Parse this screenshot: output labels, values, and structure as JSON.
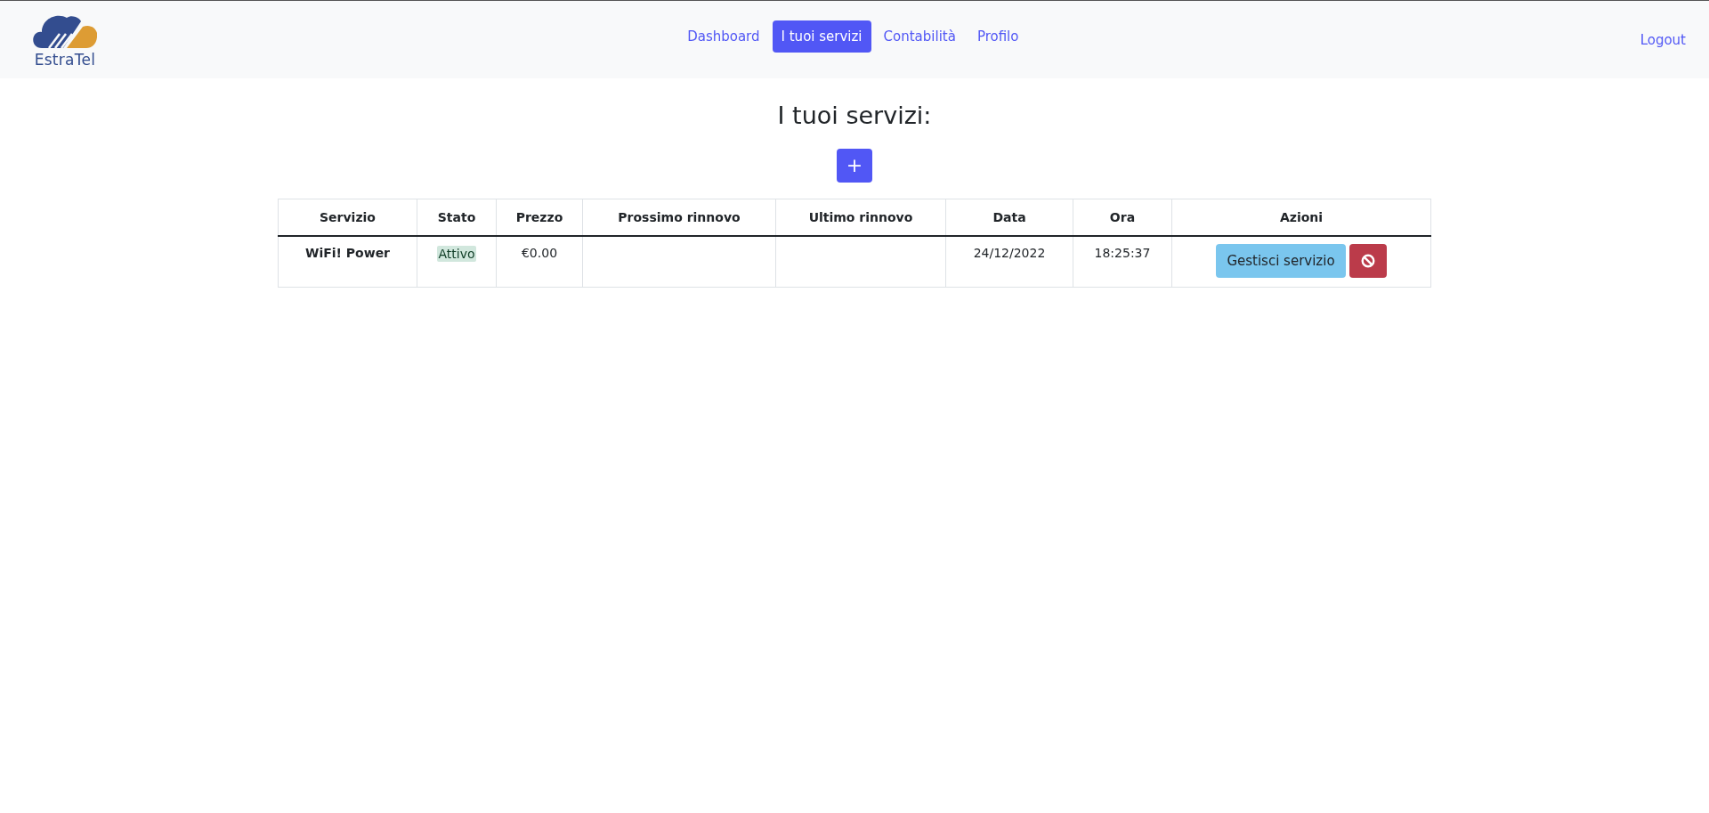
{
  "brand": {
    "name": "EstraTel"
  },
  "nav": [
    {
      "label": "Dashboard",
      "selected": false
    },
    {
      "label": "I tuoi servizi",
      "selected": true
    },
    {
      "label": "Contabilità",
      "selected": false
    },
    {
      "label": "Profilo",
      "selected": false
    }
  ],
  "logout": "Logout",
  "page_title": "I tuoi servizi:",
  "add_button": "+",
  "table": {
    "columns": [
      "Servizio",
      "Stato",
      "Prezzo",
      "Prossimo rinnovo",
      "Ultimo rinnovo",
      "Data",
      "Ora",
      "Azioni"
    ],
    "rows": [
      {
        "service": "WiFi! Power",
        "status": {
          "text": "Attivo",
          "color": "#d1e7dd"
        },
        "price": "€0.00",
        "date": "24/12/2022",
        "time": "18:25:37",
        "manage_button": "Gestisci servizio"
      }
    ]
  }
}
